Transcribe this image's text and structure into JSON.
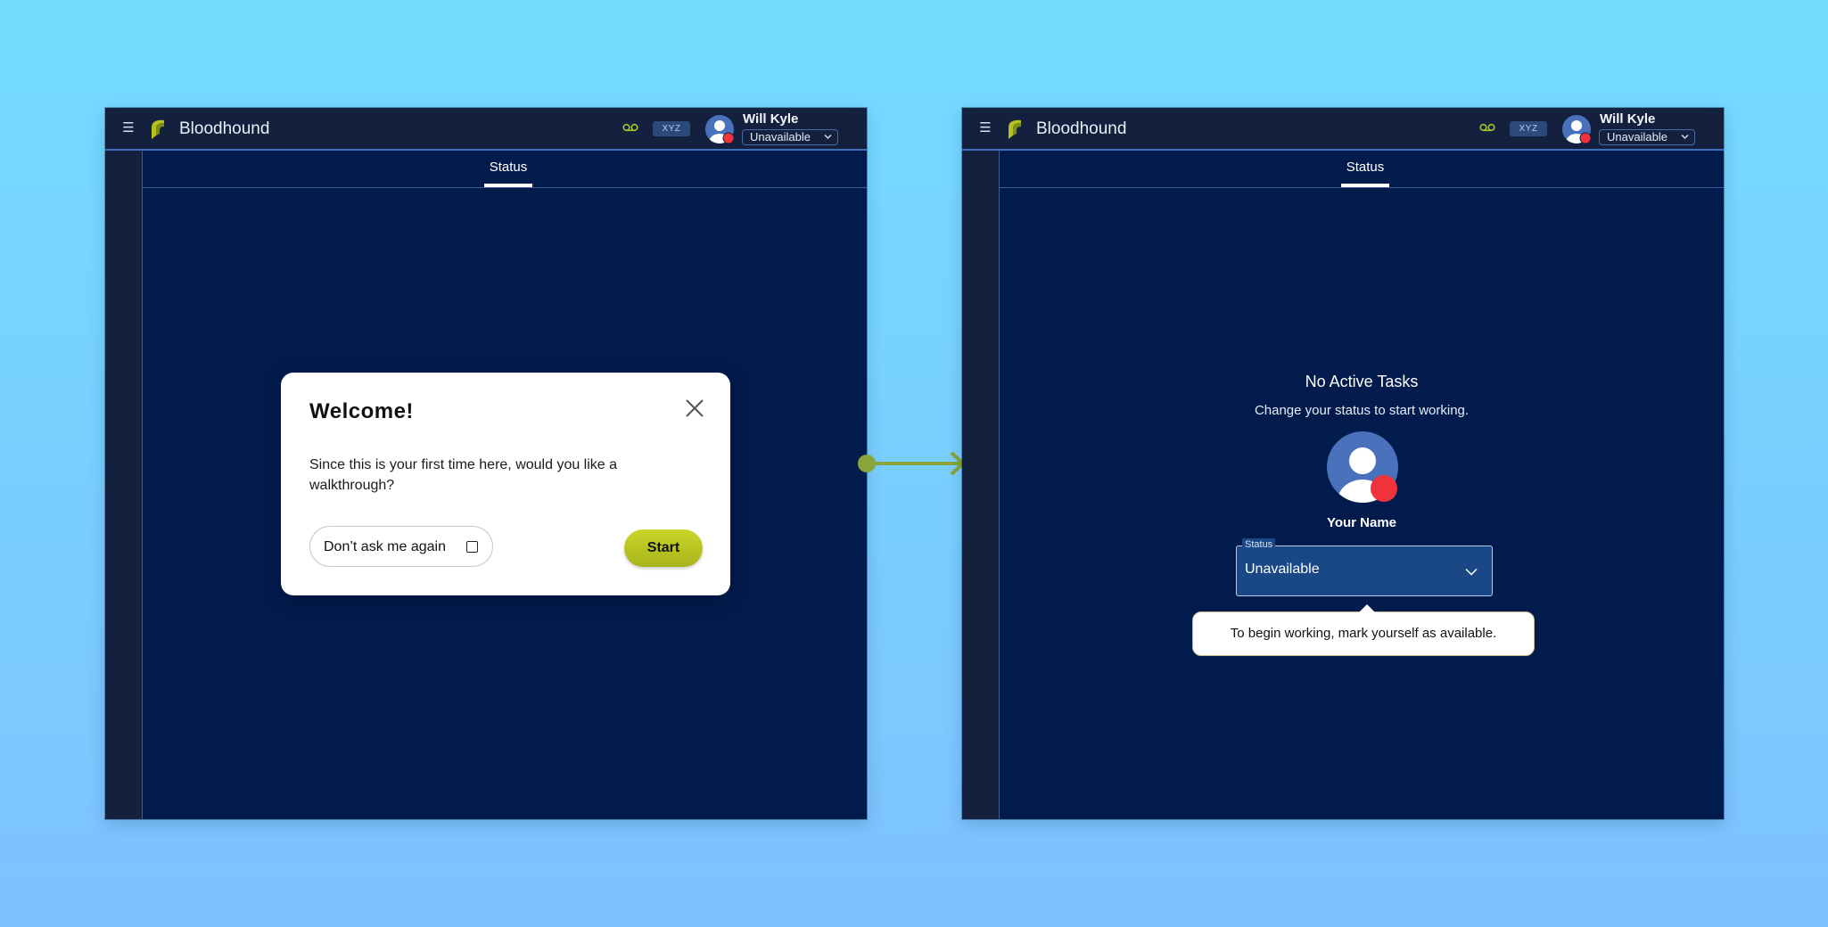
{
  "colors": {
    "background": "#74dcff",
    "frame_bg": "#021b4d",
    "topbar_bg": "#13213f",
    "accent": "#b5c11f",
    "status_red": "#f0333a",
    "avatar_blue": "#4a72bc"
  },
  "left": {
    "app": {
      "menu_icon": "hamburger-icon",
      "brand": "Bloodhound",
      "voicemail_icon": "voicemail-icon",
      "org_chip": "XYZ",
      "user_name": "Will Kyle",
      "user_status": "Unavailable"
    },
    "tabs": [
      {
        "label": "Status",
        "active": true
      }
    ],
    "modal": {
      "title": "Welcome!",
      "body": "Since this is your first time here, would you like a walkthrough?",
      "dont_ask_label": "Don’t ask me again",
      "dont_ask_checked": false,
      "start_label": "Start",
      "close_icon": "close-icon"
    }
  },
  "right": {
    "app": {
      "menu_icon": "hamburger-icon",
      "brand": "Bloodhound",
      "voicemail_icon": "voicemail-icon",
      "org_chip": "XYZ",
      "user_name": "Will Kyle",
      "user_status": "Unavailable"
    },
    "tabs": [
      {
        "label": "Status",
        "active": true
      }
    ],
    "empty_state": {
      "title": "No Active Tasks",
      "subtitle": "Change your status to start working.",
      "name": "Your Name",
      "status_label": "Status",
      "status_value": "Unavailable",
      "tooltip": "To begin working, mark yourself as available."
    }
  }
}
